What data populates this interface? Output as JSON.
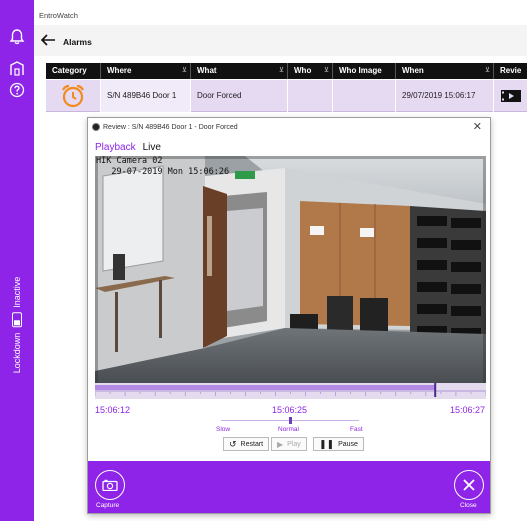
{
  "app": {
    "title": "EntroWatch"
  },
  "rail": {
    "lockdown_label": "Lockdown",
    "lockdown_state": "Inactive",
    "accent": "#8e24e8"
  },
  "header": {
    "page_title": "Alarms"
  },
  "table": {
    "columns": [
      {
        "label": "Category",
        "filter": false
      },
      {
        "label": "Where",
        "filter": true
      },
      {
        "label": "What",
        "filter": true
      },
      {
        "label": "Who",
        "filter": true
      },
      {
        "label": "Who Image",
        "filter": false
      },
      {
        "label": "When",
        "filter": true
      },
      {
        "label": "Revie",
        "filter": false
      }
    ],
    "rows": [
      {
        "category_icon": "alarm-clock-icon",
        "where": "S/N 489B46 Door 1",
        "what": "Door Forced",
        "who": "",
        "who_image": "",
        "when": "29/07/2019 15:06:17",
        "review_icon": "video-icon"
      }
    ]
  },
  "dialog": {
    "title": "Review : S/N 489B46 Door 1 - Door Forced",
    "tabs": {
      "playback": "Playback",
      "live": "Live"
    },
    "osd": {
      "camera": "HIK Camera 02",
      "timestamp": "29-07-2019 Mon 15:06:26"
    },
    "timeline": {
      "start": "15:06:12",
      "current": "15:06:25",
      "end": "15:06:27",
      "progress": 0.87
    },
    "speed": {
      "slow": "Slow",
      "normal": "Normal",
      "fast": "Fast",
      "level": 0.5
    },
    "controls": {
      "restart": "Restart",
      "play": "Play",
      "pause": "Pause"
    },
    "footer": {
      "capture": "Capture",
      "close": "Close"
    }
  }
}
